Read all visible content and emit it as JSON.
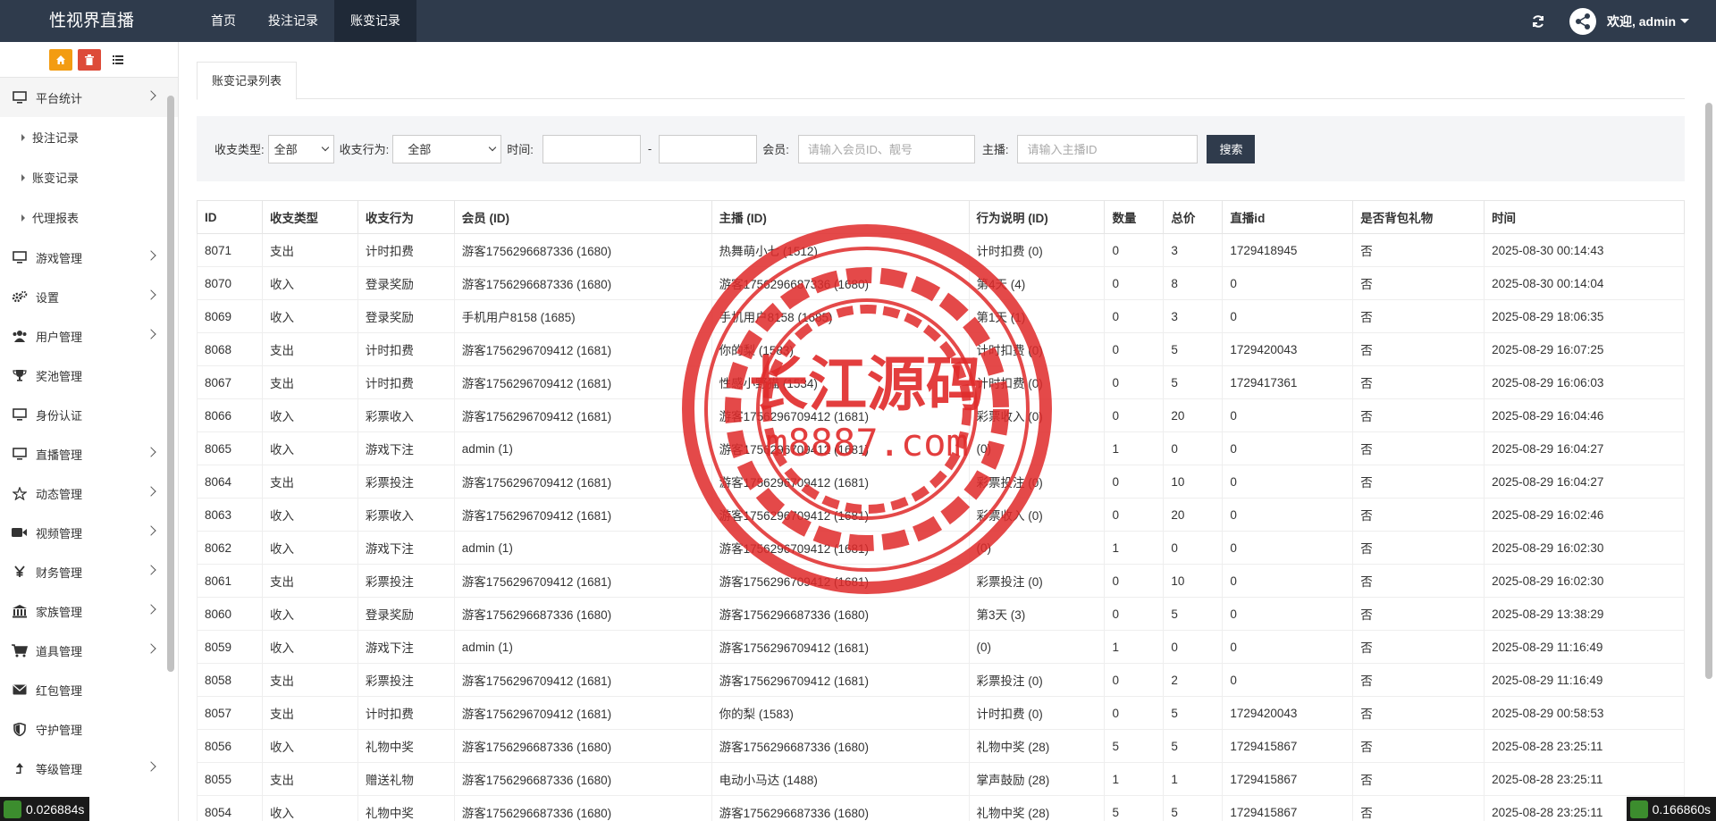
{
  "navbar": {
    "brand": "性视界直播",
    "tabs": [
      {
        "label": "首页"
      },
      {
        "label": "投注记录"
      },
      {
        "label": "账变记录"
      }
    ],
    "welcome": "欢迎, admin"
  },
  "sidebar": {
    "items": [
      {
        "label": "平台统计",
        "icon": "monitor-icon",
        "open": true,
        "children": [
          "投注记录",
          "账变记录",
          "代理报表"
        ]
      },
      {
        "label": "游戏管理",
        "icon": "monitor-icon"
      },
      {
        "label": "设置",
        "icon": "gears-icon"
      },
      {
        "label": "用户管理",
        "icon": "users-icon"
      },
      {
        "label": "奖池管理",
        "icon": "trophy-icon"
      },
      {
        "label": "身份认证",
        "icon": "monitor-icon"
      },
      {
        "label": "直播管理",
        "icon": "monitor-icon"
      },
      {
        "label": "动态管理",
        "icon": "star-icon"
      },
      {
        "label": "视频管理",
        "icon": "video-icon"
      },
      {
        "label": "财务管理",
        "icon": "yen-icon"
      },
      {
        "label": "家族管理",
        "icon": "bank-icon"
      },
      {
        "label": "道具管理",
        "icon": "cart-icon"
      },
      {
        "label": "红包管理",
        "icon": "envelope-icon"
      },
      {
        "label": "守护管理",
        "icon": "shield-icon"
      },
      {
        "label": "等级管理",
        "icon": "level-up-icon"
      }
    ]
  },
  "page_tab": "账变记录列表",
  "filter": {
    "type_label": "收支类型:",
    "type_value": "全部",
    "action_label": "收支行为:",
    "action_value": "全部",
    "time_label": "时间:",
    "time_sep": "-",
    "member_label": "会员:",
    "member_placeholder": "请输入会员ID、靓号",
    "anchor_label": "主播:",
    "anchor_placeholder": "请输入主播ID",
    "search_label": "搜索"
  },
  "table": {
    "headers": [
      "ID",
      "收支类型",
      "收支行为",
      "会员 (ID)",
      "主播 (ID)",
      "行为说明 (ID)",
      "数量",
      "总价",
      "直播id",
      "是否背包礼物",
      "时间"
    ],
    "rows": [
      [
        "8071",
        "支出",
        "计时扣费",
        "游客1756296687336 (1680)",
        "热舞萌小七 (1512)",
        "计时扣费 (0)",
        "0",
        "3",
        "1729418945",
        "否",
        "2025-08-30 00:14:43"
      ],
      [
        "8070",
        "收入",
        "登录奖励",
        "游客1756296687336 (1680)",
        "游客1756296687336 (1680)",
        "第4天 (4)",
        "0",
        "8",
        "0",
        "否",
        "2025-08-30 00:14:04"
      ],
      [
        "8069",
        "收入",
        "登录奖励",
        "手机用户8158 (1685)",
        "手机用户8158 (1685)",
        "第1天 (1)",
        "0",
        "3",
        "0",
        "否",
        "2025-08-29 18:06:35"
      ],
      [
        "8068",
        "支出",
        "计时扣费",
        "游客1756296709412 (1681)",
        "你的梨 (1583)",
        "计时扣费 (0)",
        "0",
        "5",
        "1729420043",
        "否",
        "2025-08-29 16:07:25"
      ],
      [
        "8067",
        "支出",
        "计时扣费",
        "游客1756296709412 (1681)",
        "性感小野猫 (1534)",
        "计时扣费 (0)",
        "0",
        "5",
        "1729417361",
        "否",
        "2025-08-29 16:06:03"
      ],
      [
        "8066",
        "收入",
        "彩票收入",
        "游客1756296709412 (1681)",
        "游客1756296709412 (1681)",
        "彩票收入 (0)",
        "0",
        "20",
        "0",
        "否",
        "2025-08-29 16:04:46"
      ],
      [
        "8065",
        "收入",
        "游戏下注",
        "admin (1)",
        "游客1756296709412 (1681)",
        "(0)",
        "1",
        "0",
        "0",
        "否",
        "2025-08-29 16:04:27"
      ],
      [
        "8064",
        "支出",
        "彩票投注",
        "游客1756296709412 (1681)",
        "游客1756296709412 (1681)",
        "彩票投注 (0)",
        "0",
        "10",
        "0",
        "否",
        "2025-08-29 16:04:27"
      ],
      [
        "8063",
        "收入",
        "彩票收入",
        "游客1756296709412 (1681)",
        "游客1756296709412 (1681)",
        "彩票收入 (0)",
        "0",
        "20",
        "0",
        "否",
        "2025-08-29 16:02:46"
      ],
      [
        "8062",
        "收入",
        "游戏下注",
        "admin (1)",
        "游客1756296709412 (1681)",
        "(0)",
        "1",
        "0",
        "0",
        "否",
        "2025-08-29 16:02:30"
      ],
      [
        "8061",
        "支出",
        "彩票投注",
        "游客1756296709412 (1681)",
        "游客1756296709412 (1681)",
        "彩票投注 (0)",
        "0",
        "10",
        "0",
        "否",
        "2025-08-29 16:02:30"
      ],
      [
        "8060",
        "收入",
        "登录奖励",
        "游客1756296687336 (1680)",
        "游客1756296687336 (1680)",
        "第3天 (3)",
        "0",
        "5",
        "0",
        "否",
        "2025-08-29 13:38:29"
      ],
      [
        "8059",
        "收入",
        "游戏下注",
        "admin (1)",
        "游客1756296709412 (1681)",
        "(0)",
        "1",
        "0",
        "0",
        "否",
        "2025-08-29 11:16:49"
      ],
      [
        "8058",
        "支出",
        "彩票投注",
        "游客1756296709412 (1681)",
        "游客1756296709412 (1681)",
        "彩票投注 (0)",
        "0",
        "2",
        "0",
        "否",
        "2025-08-29 11:16:49"
      ],
      [
        "8057",
        "支出",
        "计时扣费",
        "游客1756296709412 (1681)",
        "你的梨 (1583)",
        "计时扣费 (0)",
        "0",
        "5",
        "1729420043",
        "否",
        "2025-08-29 00:58:53"
      ],
      [
        "8056",
        "收入",
        "礼物中奖",
        "游客1756296687336 (1680)",
        "游客1756296687336 (1680)",
        "礼物中奖 (28)",
        "5",
        "5",
        "1729415867",
        "否",
        "2025-08-28 23:25:11"
      ],
      [
        "8055",
        "支出",
        "赠送礼物",
        "游客1756296687336 (1680)",
        "电动小马达 (1488)",
        "掌声鼓励 (28)",
        "1",
        "1",
        "1729415867",
        "否",
        "2025-08-28 23:25:11"
      ],
      [
        "8054",
        "收入",
        "礼物中奖",
        "游客1756296687336 (1680)",
        "游客1756296687336 (1680)",
        "礼物中奖 (28)",
        "5",
        "5",
        "1729415867",
        "否",
        "2025-08-28 23:25:11"
      ]
    ]
  },
  "watermark": {
    "line1": "长江源码",
    "line2": "m8887.com",
    "color": "#e02a2a"
  },
  "timing": {
    "left": "0.026884s",
    "right": "0.166860s"
  },
  "colors": {
    "navbar": "#2f3b4c",
    "nav_active": "#1f2937",
    "shortcut_orange": "#f39c12",
    "shortcut_red": "#dd4b39"
  }
}
